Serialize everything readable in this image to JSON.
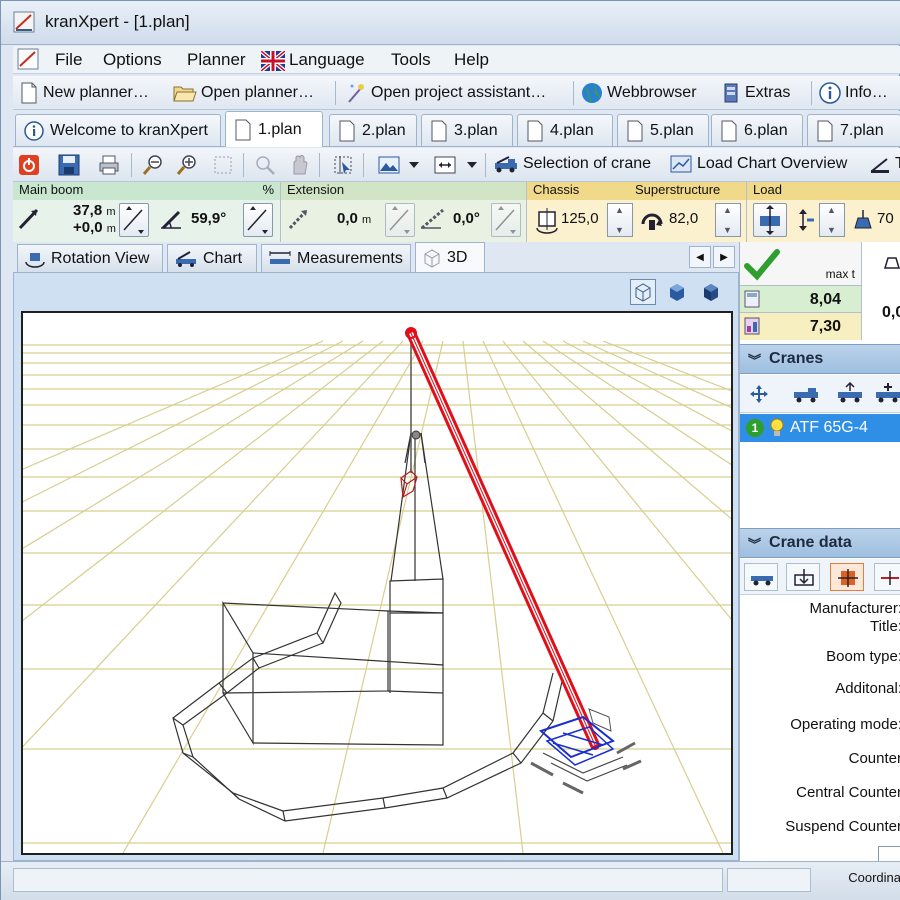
{
  "window": {
    "title": "kranXpert  - [1.plan]"
  },
  "menu": [
    "File",
    "Options",
    "Planner",
    "Language",
    "Tools",
    "Help"
  ],
  "toolbar": {
    "new_planner": "New planner…",
    "open_planner": "Open planner…",
    "open_project_assistant": "Open project assistant…",
    "webbrowser": "Webbrowser",
    "extras": "Extras",
    "info": "Info…"
  },
  "doc_tabs": [
    "Welcome to kranXpert",
    "1.plan",
    "2.plan",
    "3.plan",
    "4.plan",
    "5.plan",
    "6.plan",
    "7.plan"
  ],
  "toolbar2": {
    "selection_of_crane": "Selection of crane",
    "load_chart_overview": "Load Chart Overview",
    "truncated": "T"
  },
  "params": {
    "main_boom": {
      "header": "Main boom",
      "pct": "%",
      "length": "37,8",
      "length_unit": "m",
      "length_extra": "+0,0",
      "length_extra_unit": "m",
      "angle": "59,9°"
    },
    "extension": {
      "header": "Extension",
      "length": "0,0",
      "length_unit": "m",
      "angle": "0,0°"
    },
    "chassis": {
      "header": "Chassis",
      "value": "125,0"
    },
    "superstructure": {
      "header": "Superstructure",
      "value": "82,0"
    },
    "load": {
      "header": "Load",
      "value_partial": "70"
    }
  },
  "view_tabs": [
    "Rotation View",
    "Chart",
    "Measurements",
    "3D"
  ],
  "load_table": {
    "max_label": "max t",
    "row1": "8,04",
    "row2": "7,30",
    "partial": "0,0"
  },
  "cranes": {
    "header": "Cranes",
    "items": [
      {
        "index": "1",
        "name": "ATF 65G-4"
      }
    ]
  },
  "crane_data": {
    "header": "Crane data",
    "fields": [
      "Manufacturer:",
      "Title:",
      "Boom type:",
      "Additonal:",
      "Operating mode:",
      "Counter",
      "Central Counter",
      "Suspend Counter"
    ]
  },
  "status": {
    "coordinates": "Coordina"
  },
  "colors": {
    "accent_green": "#2e9e2e",
    "boom_red": "#e0101a",
    "crane_blue": "#1a2fd0",
    "grid_tan": "#d6cf8f",
    "header_bg": "#a8c6e6"
  }
}
